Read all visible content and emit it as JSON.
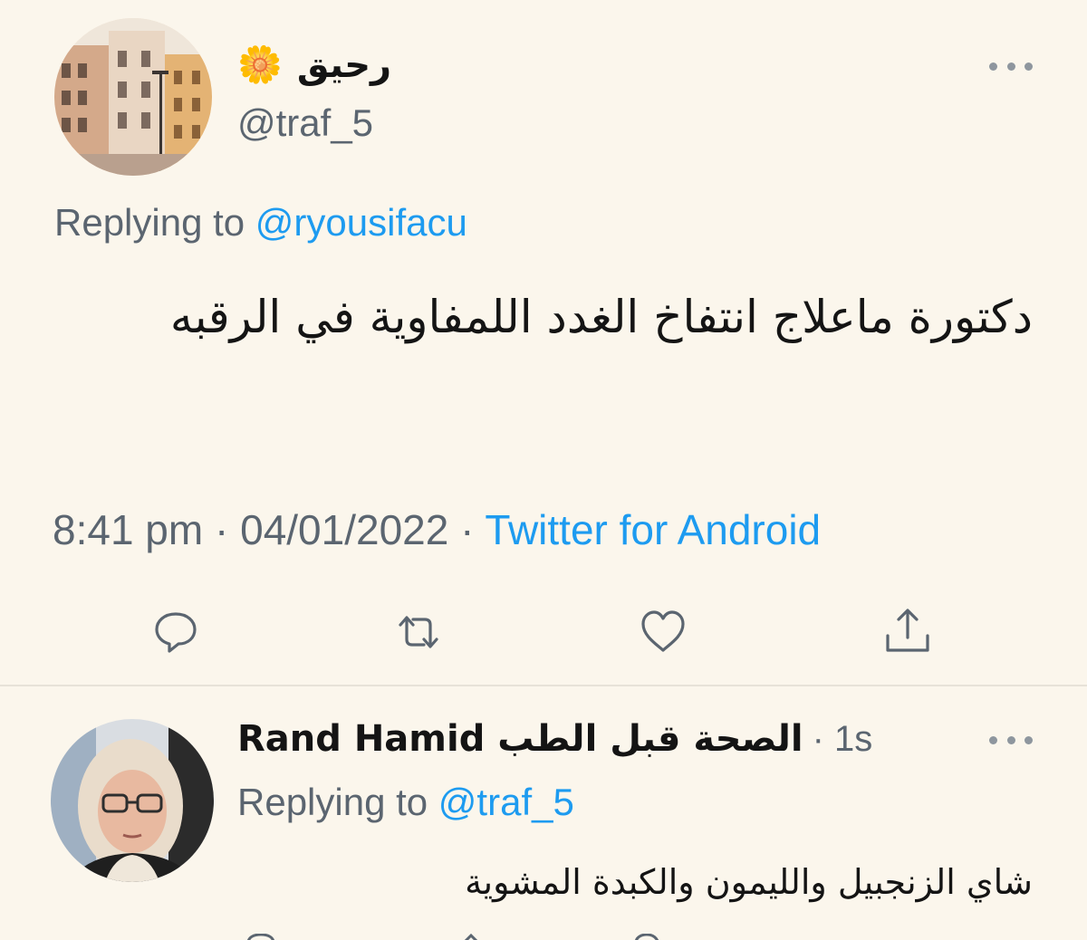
{
  "main_tweet": {
    "display_name": "رحيق",
    "name_emoji": "🌼",
    "handle": "@traf_5",
    "replying_prefix": "Replying to",
    "replying_to": "@ryousifacu",
    "text": "دكتورة ماعلاج انتفاخ الغدد اللمفاوية في الرقبه",
    "time": "8:41 pm",
    "date": "04/01/2022",
    "separator": "·",
    "source": "Twitter for Android",
    "more_icon": "more-horizontal-icon",
    "actions": [
      {
        "name": "reply",
        "icon": "comment-icon"
      },
      {
        "name": "retweet",
        "icon": "retweet-icon"
      },
      {
        "name": "like",
        "icon": "heart-icon"
      },
      {
        "name": "share",
        "icon": "share-icon"
      }
    ]
  },
  "reply_tweet": {
    "display_name": "Rand Hamid الصحة قبل الطب",
    "separator": "·",
    "time_ago": "1s",
    "replying_prefix": "Replying to",
    "replying_to": "@traf_5",
    "text": "شاي الزنجبيل والليمون والكبدة المشوية"
  },
  "colors": {
    "background": "#fbf6ec",
    "text": "#141414",
    "secondary": "#5b6570",
    "link": "#1d9bf0"
  }
}
